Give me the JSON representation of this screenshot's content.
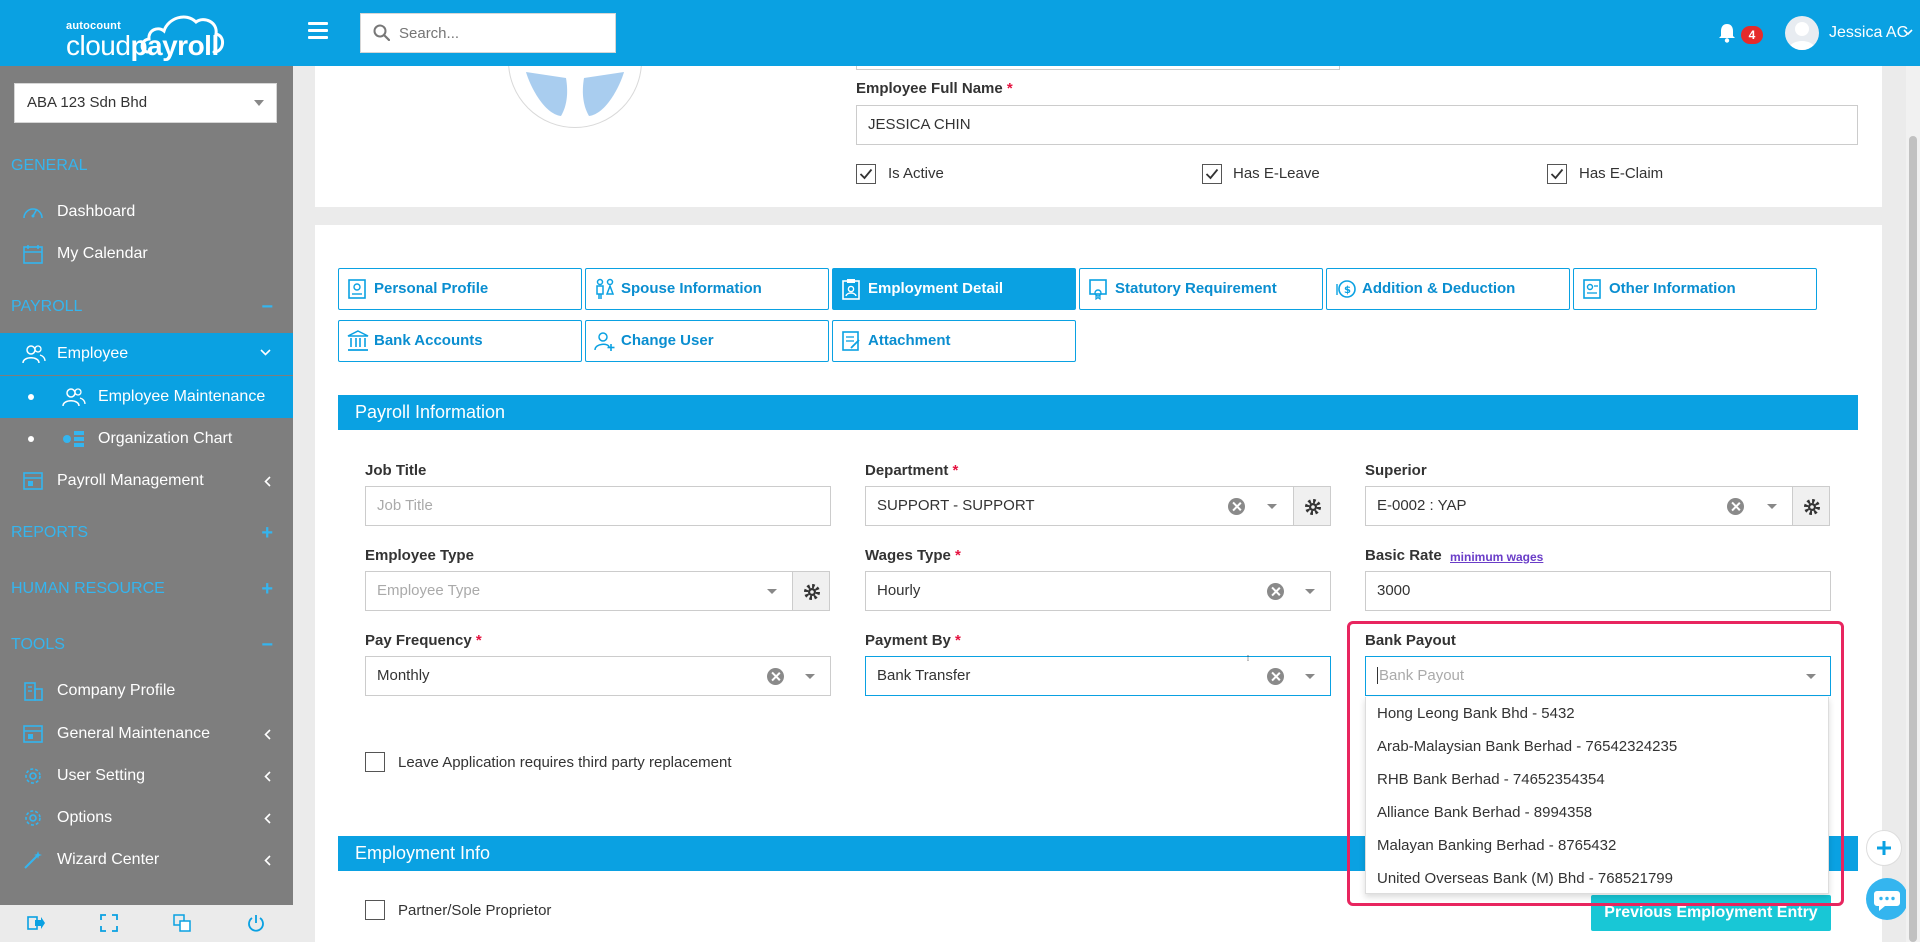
{
  "brand": {
    "small": "autocount",
    "name_light": "cloud",
    "name_bold": "payroll"
  },
  "search": {
    "placeholder": "Search..."
  },
  "notifications": {
    "count": "4"
  },
  "user": {
    "name": "Jessica AC"
  },
  "company": {
    "selected": "ABA 123 Sdn Bhd"
  },
  "sidebar": {
    "general": "GENERAL",
    "dashboard": "Dashboard",
    "my_calendar": "My Calendar",
    "payroll": "PAYROLL",
    "employee": "Employee",
    "employee_maintenance": "Employee Maintenance",
    "organization_chart": "Organization Chart",
    "payroll_management": "Payroll Management",
    "reports": "REPORTS",
    "human_resource": "HUMAN RESOURCE",
    "tools": "TOOLS",
    "company_profile": "Company Profile",
    "general_maintenance": "General Maintenance",
    "user_setting": "User Setting",
    "options": "Options",
    "wizard_center": "Wizard Center",
    "minus": "−",
    "plus": "+"
  },
  "header_card": {
    "full_name_label": "Employee Full Name",
    "full_name_value": "JESSICA CHIN",
    "is_active": "Is Active",
    "has_eleave": "Has E-Leave",
    "has_eclaim": "Has E-Claim",
    "required_mark": "*"
  },
  "tabs": {
    "personal_profile": "Personal Profile",
    "spouse_information": "Spouse Information",
    "employment_detail": "Employment Detail",
    "statutory_requirement": "Statutory Requirement",
    "addition_deduction": "Addition & Deduction",
    "other_information": "Other Information",
    "bank_accounts": "Bank Accounts",
    "change_user": "Change User",
    "attachment": "Attachment"
  },
  "payroll_info": {
    "title": "Payroll Information",
    "job_title_label": "Job Title",
    "job_title_placeholder": "Job Title",
    "department_label": "Department",
    "department_value": "SUPPORT - SUPPORT",
    "superior_label": "Superior",
    "superior_value": "E-0002 : YAP",
    "employee_type_label": "Employee Type",
    "employee_type_placeholder": "Employee Type",
    "wages_type_label": "Wages Type",
    "wages_type_value": "Hourly",
    "basic_rate_label": "Basic Rate",
    "minimum_wages_link": "minimum wages",
    "basic_rate_value": "3000",
    "pay_frequency_label": "Pay Frequency",
    "pay_frequency_value": "Monthly",
    "payment_by_label": "Payment By",
    "payment_by_value": "Bank Transfer",
    "bank_payout_label": "Bank Payout",
    "bank_payout_placeholder": "Bank Payout",
    "leave_replacement_label": "Leave Application requires third party replacement",
    "bank_options": [
      "Hong Leong Bank Bhd - 5432",
      "Arab-Malaysian Bank Berhad - 76542324235",
      "RHB Bank Berhad - 74652354354",
      "Alliance Bank Berhad - 8994358",
      "Malayan Banking Berhad - 8765432",
      "United Overseas Bank (M) Bhd - 768521799"
    ]
  },
  "employment_info": {
    "title": "Employment Info",
    "partner_label": "Partner/Sole Proprietor",
    "prev_employment_button": "Previous Employment Entry"
  },
  "colors": {
    "primary": "#0aa1e2",
    "sidebar": "#7e7e7e",
    "accent": "#e8255f",
    "teal": "#18c7d6"
  }
}
